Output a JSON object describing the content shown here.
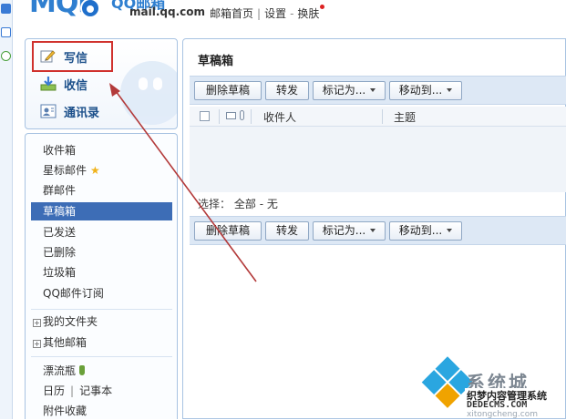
{
  "header": {
    "logo_mark": "MQil",
    "logo_text": "QQ邮箱",
    "logo_domain": "mail.qq.com",
    "nav": [
      "邮箱首页",
      "设置",
      "换肤"
    ]
  },
  "sidebar": {
    "actions": [
      {
        "label": "写信",
        "icon": "pencil-icon"
      },
      {
        "label": "收信",
        "icon": "inbox-download-icon"
      },
      {
        "label": "通讯录",
        "icon": "contacts-icon"
      }
    ],
    "folders": [
      {
        "label": "收件箱"
      },
      {
        "label": "星标邮件"
      },
      {
        "label": "群邮件"
      },
      {
        "label": "草稿箱",
        "active": true
      },
      {
        "label": "已发送"
      },
      {
        "label": "已删除"
      },
      {
        "label": "垃圾箱"
      },
      {
        "label": "QQ邮件订阅"
      }
    ],
    "my_folders": "我的文件夹",
    "other_mailboxes": "其他邮箱",
    "drift_bottle": "漂流瓶",
    "calendar": "日历",
    "notepad": "记事本",
    "attachments": "附件收藏"
  },
  "main": {
    "title": "草稿箱",
    "toolbar": {
      "delete": "删除草稿",
      "forward": "转发",
      "mark_as": "标记为...",
      "move_to": "移动到..."
    },
    "columns": {
      "recipient": "收件人",
      "subject": "主题"
    },
    "select": {
      "label": "选择：",
      "all": "全部",
      "dash": "-",
      "none": "无"
    }
  },
  "watermark": {
    "title": "系统城",
    "subtitle": "织梦内容管理系统",
    "domain": "DEDECMS.COM",
    "url": "xitongcheng.com"
  },
  "colors": {
    "accent": "#3d6db6",
    "highlight_box": "#d0312d",
    "arrow": "#b33a3a",
    "toolbar_bg": "#dde8f5"
  }
}
